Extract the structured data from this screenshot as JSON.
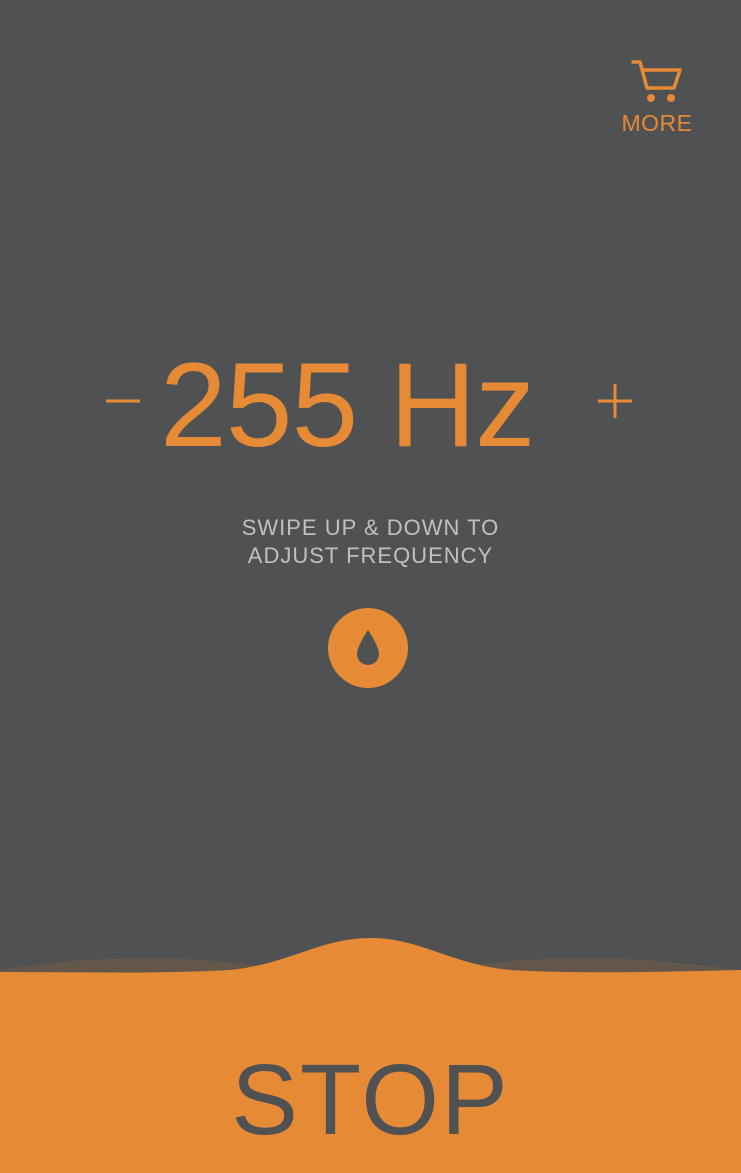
{
  "header": {
    "more_label": "MORE",
    "more_icon": "cart-icon"
  },
  "frequency": {
    "minus_label": "-",
    "value_text": "255 Hz",
    "value": 255,
    "unit": "Hz",
    "plus_label": "+"
  },
  "hint": {
    "line1": "SWIPE UP & DOWN TO",
    "line2": "ADJUST FREQUENCY"
  },
  "mode_button": {
    "icon": "water-drop-icon"
  },
  "footer": {
    "stop_label": "STOP"
  },
  "colors": {
    "background": "#505153",
    "accent": "#E68A36",
    "hint_text": "#BFC0C2"
  }
}
